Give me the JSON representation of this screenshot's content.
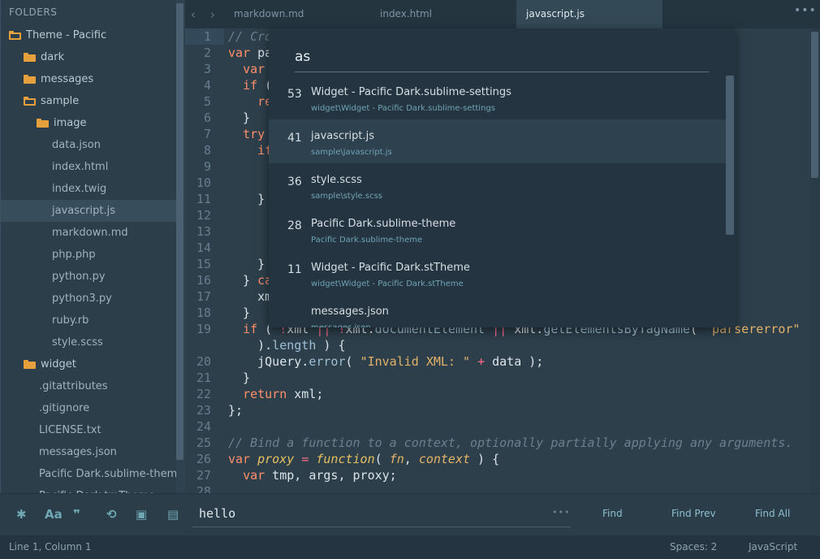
{
  "sidebar": {
    "header": "FOLDERS",
    "items": [
      {
        "label": "Theme - Pacific",
        "kind": "folder-open"
      },
      {
        "label": "dark",
        "kind": "folder"
      },
      {
        "label": "messages",
        "kind": "folder"
      },
      {
        "label": "sample",
        "kind": "folder-open"
      },
      {
        "label": "image",
        "kind": "folder"
      },
      {
        "label": "data.json",
        "kind": "file"
      },
      {
        "label": "index.html",
        "kind": "file"
      },
      {
        "label": "index.twig",
        "kind": "file"
      },
      {
        "label": "javascript.js",
        "kind": "file",
        "selected": true
      },
      {
        "label": "markdown.md",
        "kind": "file"
      },
      {
        "label": "php.php",
        "kind": "file"
      },
      {
        "label": "python.py",
        "kind": "file"
      },
      {
        "label": "python3.py",
        "kind": "file"
      },
      {
        "label": "ruby.rb",
        "kind": "file"
      },
      {
        "label": "style.scss",
        "kind": "file"
      },
      {
        "label": "widget",
        "kind": "folder"
      },
      {
        "label": ".gitattributes",
        "kind": "file"
      },
      {
        "label": ".gitignore",
        "kind": "file"
      },
      {
        "label": "LICENSE.txt",
        "kind": "file"
      },
      {
        "label": "messages.json",
        "kind": "file"
      },
      {
        "label": "Pacific Dark.sublime-theme",
        "kind": "file"
      },
      {
        "label": "Pacific Dark.tmTheme",
        "kind": "file"
      }
    ]
  },
  "tabs": [
    {
      "label": "markdown.md",
      "active": false
    },
    {
      "label": "index.html",
      "active": false
    },
    {
      "label": "javascript.js",
      "active": true
    }
  ],
  "tab_more": "•••",
  "editor": {
    "lines": [
      {
        "n": "1",
        "s": [
          [
            "c-com",
            "// Cro"
          ]
        ]
      },
      {
        "n": "2",
        "s": [
          [
            "c-kw",
            "var"
          ],
          [
            "",
            " pa"
          ]
        ]
      },
      {
        "n": "3",
        "s": [
          [
            "",
            "  "
          ],
          [
            "c-kw",
            "var"
          ]
        ]
      },
      {
        "n": "4",
        "s": [
          [
            "",
            "  "
          ],
          [
            "c-kw",
            "if"
          ],
          [
            "",
            " ("
          ]
        ]
      },
      {
        "n": "5",
        "s": [
          [
            "",
            "    "
          ],
          [
            "c-kw",
            "re"
          ]
        ]
      },
      {
        "n": "6",
        "s": [
          [
            "",
            "  }"
          ]
        ]
      },
      {
        "n": "7",
        "s": [
          [
            "",
            "  "
          ],
          [
            "c-kw",
            "try"
          ]
        ]
      },
      {
        "n": "8",
        "s": [
          [
            "",
            "    "
          ],
          [
            "c-kw",
            "if"
          ]
        ]
      },
      {
        "n": "9",
        "s": []
      },
      {
        "n": "10",
        "s": []
      },
      {
        "n": "11",
        "s": [
          [
            "",
            "    }"
          ]
        ]
      },
      {
        "n": "12",
        "s": []
      },
      {
        "n": "13",
        "s": []
      },
      {
        "n": "14",
        "s": []
      },
      {
        "n": "15",
        "s": [
          [
            "",
            "    }"
          ]
        ]
      },
      {
        "n": "16",
        "s": [
          [
            "",
            "  } "
          ],
          [
            "c-kw",
            "ca"
          ]
        ]
      },
      {
        "n": "17",
        "s": [
          [
            "",
            "    xm"
          ]
        ]
      },
      {
        "n": "18",
        "s": [
          [
            "",
            "  }"
          ]
        ]
      },
      {
        "n": "19",
        "s": [
          [
            "",
            "  "
          ],
          [
            "c-kw",
            "if"
          ],
          [
            "",
            " ( "
          ],
          [
            "c-op",
            "!"
          ],
          [
            "",
            "xml "
          ],
          [
            "c-op",
            "||"
          ],
          [
            "",
            " "
          ],
          [
            "c-op",
            "!"
          ],
          [
            "",
            "xml."
          ],
          [
            "c-prop",
            "documentElement"
          ],
          [
            "",
            " "
          ],
          [
            "c-op",
            "||"
          ],
          [
            "",
            " xml."
          ],
          [
            "c-prop",
            "getElementsByTagName"
          ],
          [
            "",
            "( "
          ],
          [
            "c-str",
            "\"parsererror\""
          ]
        ]
      },
      {
        "n": "",
        "s": [
          [
            "",
            "    )."
          ],
          [
            "c-prop",
            "length"
          ],
          [
            "",
            " ) {"
          ]
        ]
      },
      {
        "n": "20",
        "s": [
          [
            "",
            "    jQuery."
          ],
          [
            "c-prop",
            "error"
          ],
          [
            "",
            "( "
          ],
          [
            "c-str",
            "\"Invalid XML: \""
          ],
          [
            "",
            " "
          ],
          [
            "c-op",
            "+"
          ],
          [
            "",
            " data );"
          ]
        ]
      },
      {
        "n": "21",
        "s": [
          [
            "",
            "  }"
          ]
        ]
      },
      {
        "n": "22",
        "s": [
          [
            "",
            "  "
          ],
          [
            "c-kw",
            "return"
          ],
          [
            "",
            " xml;"
          ]
        ]
      },
      {
        "n": "23",
        "s": [
          [
            "",
            "};"
          ]
        ]
      },
      {
        "n": "24",
        "s": []
      },
      {
        "n": "25",
        "s": [
          [
            "c-com",
            "// Bind a function to a context, optionally partially applying any arguments."
          ]
        ]
      },
      {
        "n": "26",
        "s": [
          [
            "c-kw",
            "var"
          ],
          [
            "",
            " "
          ],
          [
            "c-fn",
            "proxy"
          ],
          [
            "",
            " "
          ],
          [
            "c-op",
            "="
          ],
          [
            "",
            " "
          ],
          [
            "c-fn",
            "function"
          ],
          [
            "",
            "( "
          ],
          [
            "c-par",
            "fn"
          ],
          [
            "",
            ", "
          ],
          [
            "c-par",
            "context"
          ],
          [
            "",
            " ) {"
          ]
        ]
      },
      {
        "n": "27",
        "s": [
          [
            "",
            "  "
          ],
          [
            "c-kw",
            "var"
          ],
          [
            "",
            " tmp, args, proxy;"
          ]
        ]
      },
      {
        "n": "28",
        "s": []
      }
    ]
  },
  "quick_open": {
    "query": "as",
    "results": [
      {
        "score": "53",
        "title": "Widget - Pacific Dark.sublime-settings",
        "path": "widget\\Widget - Pacific Dark.sublime-settings"
      },
      {
        "score": "41",
        "title": "javascript.js",
        "path": "sample\\javascript.js",
        "selected": true
      },
      {
        "score": "36",
        "title": "style.scss",
        "path": "sample\\style.scss"
      },
      {
        "score": "28",
        "title": "Pacific Dark.sublime-theme",
        "path": "Pacific Dark.sublime-theme"
      },
      {
        "score": "11",
        "title": "Widget - Pacific Dark.stTheme",
        "path": "widget\\Widget - Pacific Dark.stTheme"
      },
      {
        "score": "",
        "title": "messages.json",
        "path": "messages.json"
      }
    ]
  },
  "find_panel": {
    "value": "hello",
    "dots": "•••",
    "find_label": "Find",
    "find_prev_label": "Find Prev",
    "find_all_label": "Find All",
    "toggles": [
      {
        "name": "regex-toggle-icon",
        "glyph": "✱"
      },
      {
        "name": "case-sensitive-toggle-icon",
        "glyph": "Aa"
      },
      {
        "name": "whole-word-toggle-icon",
        "glyph": "❞"
      },
      {
        "name": "wrap-toggle-icon",
        "glyph": "⟲"
      },
      {
        "name": "in-selection-toggle-icon",
        "glyph": "▣"
      },
      {
        "name": "highlight-matches-toggle-icon",
        "glyph": "▤"
      }
    ]
  },
  "status_bar": {
    "position": "Line 1, Column 1",
    "indentation": "Spaces: 2",
    "syntax": "JavaScript"
  },
  "colors": {
    "accent": "#6fa8b3",
    "folder": "#e6a13c",
    "keyword": "#ff8f6b",
    "string": "#e3b26a"
  }
}
